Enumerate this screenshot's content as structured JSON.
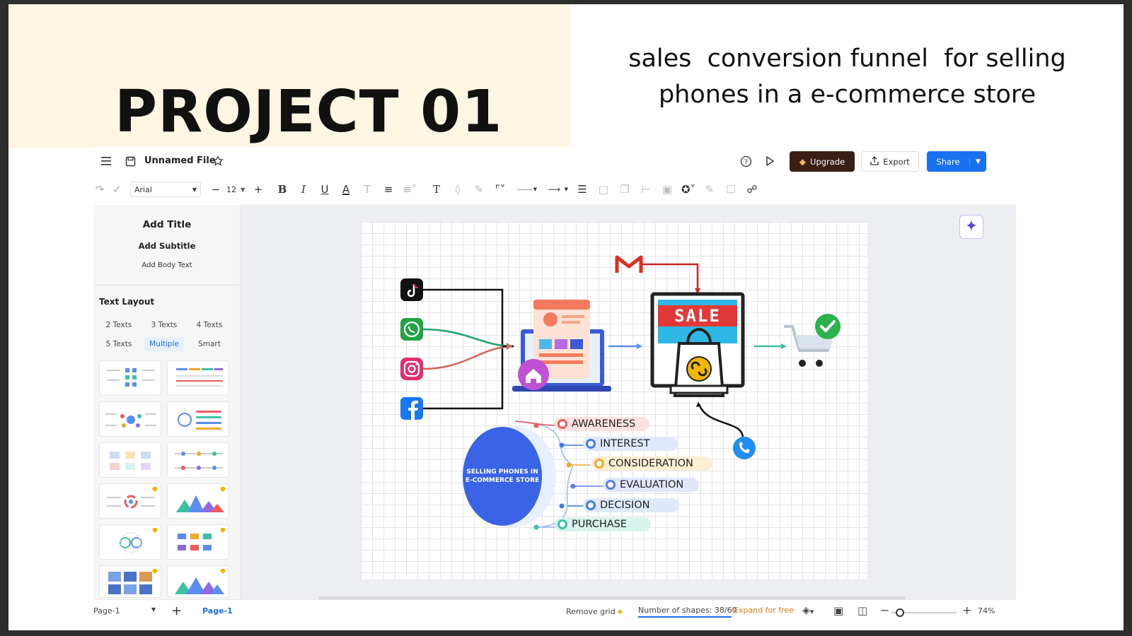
{
  "slide": {
    "title": "PROJECT 01",
    "subtitle_line1": "sales  conversion funnel  for selling",
    "subtitle_line2": "phones in a e-commerce store"
  },
  "header": {
    "file_name": "Unnamed File",
    "upgrade_label": "Upgrade",
    "export_label": "Export",
    "share_label": "Share"
  },
  "toolbar": {
    "font_family": "Arial",
    "font_size": "12"
  },
  "left_panel": {
    "add_title": "Add Title",
    "add_subtitle": "Add Subtitle",
    "add_body": "Add Body Text",
    "section_title": "Text Layout",
    "layouts": [
      "2 Texts",
      "3 Texts",
      "4 Texts",
      "5 Texts",
      "Multiple",
      "Smart"
    ],
    "active_layout": "Multiple"
  },
  "diagram": {
    "sale_sign": "SALE",
    "hub_line1": "SELLING PHONES IN",
    "hub_line2": "E-COMMERCE STORE",
    "stages": [
      {
        "label": "AWARENESS",
        "color": "#f0595e",
        "bg": "#fde1e1"
      },
      {
        "label": "INTEREST",
        "color": "#3f7de0",
        "bg": "#dfe9fb"
      },
      {
        "label": "CONSIDERATION",
        "color": "#f1a72b",
        "bg": "#fdefd3"
      },
      {
        "label": "EVALUATION",
        "color": "#5b7ee8",
        "bg": "#e2e6fb"
      },
      {
        "label": "DECISION",
        "color": "#3f7de0",
        "bg": "#dfe9fb"
      },
      {
        "label": "PURCHASE",
        "color": "#38c3a6",
        "bg": "#d8f3ec"
      }
    ]
  },
  "footer": {
    "page_select": "Page-1",
    "page_tab": "Page-1",
    "remove_grid": "Remove grid",
    "shapes_count": "Number of shapes: 38/60",
    "expand": "Expand for free",
    "zoom": "74%"
  },
  "colors": {
    "accent_blue": "#1971f0",
    "upgrade_bg": "#3a1f14",
    "cream": "#fff5e3"
  }
}
